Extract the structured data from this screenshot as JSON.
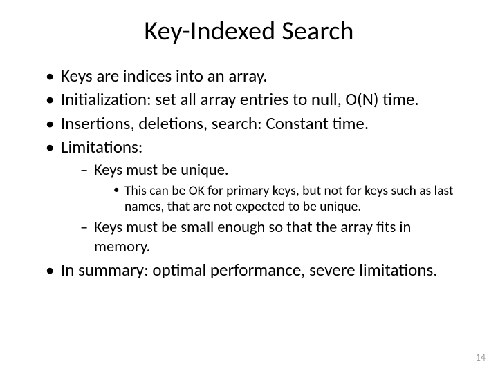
{
  "title": "Key-Indexed Search",
  "bullets": {
    "b0": "Keys are indices into an array.",
    "b1": "Initialization: set all array entries to null, O(N) time.",
    "b2": "Insertions, deletions, search: Constant time.",
    "b3": "Limitations:",
    "b3_sub0": "Keys must be unique.",
    "b3_sub0_sub0": "This can be OK for primary keys, but not for keys such as last names, that are not expected to be unique.",
    "b3_sub1": "Keys must be small enough so that the array fits in memory.",
    "b4": "In summary: optimal performance, severe limitations."
  },
  "page_number": "14"
}
